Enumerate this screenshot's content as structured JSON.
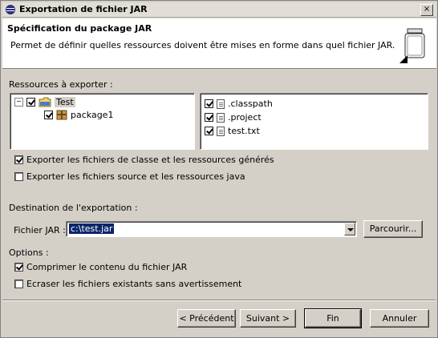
{
  "window": {
    "title": "Exportation de fichier JAR",
    "close": "×"
  },
  "header": {
    "title": "Spécification du package JAR",
    "description": "Permet de définir quelles ressources doivent être mises en forme dans quel fichier JAR."
  },
  "resources": {
    "label": "Ressources à exporter :",
    "tree": [
      {
        "label": "Test",
        "expander": "⊟",
        "checked": true
      },
      {
        "label": "package1",
        "checked": true
      }
    ],
    "files": [
      {
        "label": ".classpath",
        "checked": true
      },
      {
        "label": ".project",
        "checked": true
      },
      {
        "label": "test.txt",
        "checked": true
      }
    ]
  },
  "options_top": [
    {
      "label": "Exporter les fichiers de classe et les ressources générés",
      "checked": true
    },
    {
      "label": "Exporter les fichiers source et les ressources java",
      "checked": false
    }
  ],
  "destination": {
    "label": "Destination de l'exportation :",
    "field_label": "Fichier JAR :",
    "value": "c:\\test.jar",
    "browse": "Parcourir..."
  },
  "options": {
    "label": "Options :",
    "items": [
      {
        "label": "Comprimer le contenu du fichier JAR",
        "checked": true
      },
      {
        "label": "Ecraser les fichiers existants sans avertissement",
        "checked": false
      }
    ]
  },
  "buttons": {
    "back": "< Précédent",
    "next": "Suivant >",
    "finish": "Fin",
    "cancel": "Annuler"
  }
}
